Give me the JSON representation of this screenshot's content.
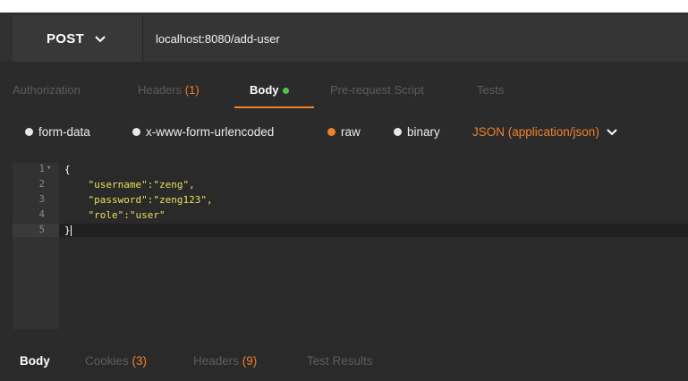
{
  "request": {
    "method": "POST",
    "url": "localhost:8080/add-user"
  },
  "tabs": [
    {
      "label": "Authorization",
      "count": ""
    },
    {
      "label": "Headers",
      "count": "(1)"
    },
    {
      "label": "Body",
      "count": ""
    },
    {
      "label": "Pre-request Script",
      "count": ""
    },
    {
      "label": "Tests",
      "count": ""
    }
  ],
  "body_options": {
    "form_data": "form-data",
    "urlencoded": "x-www-form-urlencoded",
    "raw": "raw",
    "binary": "binary",
    "content_type": "JSON (application/json)"
  },
  "editor": {
    "line_numbers": [
      "1",
      "2",
      "3",
      "4",
      "5"
    ],
    "lines": [
      "{",
      "    \"username\":\"zeng\",",
      "    \"password\":\"zeng123\",",
      "    \"role\":\"user\"",
      "}"
    ]
  },
  "response_tabs": [
    {
      "label": "Body",
      "count": ""
    },
    {
      "label": "Cookies",
      "count": "(3)"
    },
    {
      "label": "Headers",
      "count": "(9)"
    },
    {
      "label": "Test Results",
      "count": ""
    }
  ],
  "colors": {
    "accent": "#f0812a",
    "active_dot": "#4fc34f",
    "json_string": "#e6e05a"
  }
}
